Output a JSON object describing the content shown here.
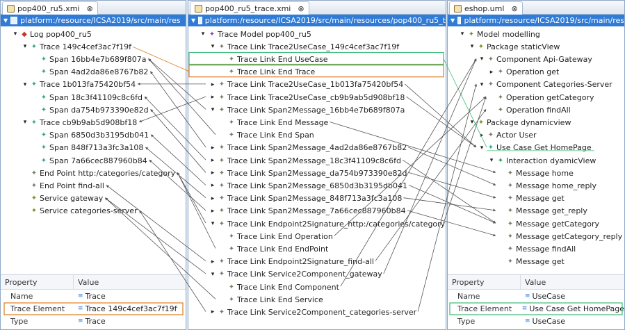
{
  "panels": {
    "left": {
      "tab_title": "pop400_ru5.xmi",
      "tab_close": "⊗",
      "path": "platform:/resource/ICSA2019/src/main/res",
      "tree": [
        {
          "label": "Log pop400_ru5",
          "depth": 1,
          "twisty": "▾",
          "icon": "◆",
          "color": "red"
        },
        {
          "label": "Trace 149c4cef3ac7f19f",
          "depth": 2,
          "twisty": "▾",
          "icon": "✦",
          "color": "teal"
        },
        {
          "label": "Span 16bb4e7b689f807a",
          "depth": 3,
          "twisty": "",
          "icon": "✦",
          "color": "teal"
        },
        {
          "label": "Span 4ad2da86e8767b82",
          "depth": 3,
          "twisty": "",
          "icon": "✦",
          "color": "teal"
        },
        {
          "label": "Trace 1b013fa75420bf54",
          "depth": 2,
          "twisty": "▾",
          "icon": "✦",
          "color": "teal"
        },
        {
          "label": "Span 18c3f41109c8c6fd",
          "depth": 3,
          "twisty": "",
          "icon": "✦",
          "color": "teal"
        },
        {
          "label": "Span da754b973390e82d",
          "depth": 3,
          "twisty": "",
          "icon": "✦",
          "color": "teal"
        },
        {
          "label": "Trace cb9b9ab5d908bf18",
          "depth": 2,
          "twisty": "▾",
          "icon": "✦",
          "color": "teal"
        },
        {
          "label": "Span 6850d3b3195db041",
          "depth": 3,
          "twisty": "",
          "icon": "✦",
          "color": "teal"
        },
        {
          "label": "Span 848f713a3fc3a108",
          "depth": 3,
          "twisty": "",
          "icon": "✦",
          "color": "teal"
        },
        {
          "label": "Span 7a66cec887960b84",
          "depth": 3,
          "twisty": "",
          "icon": "✦",
          "color": "teal"
        },
        {
          "label": "End Point http:/categories/category",
          "depth": 2,
          "twisty": "",
          "icon": "✦",
          "color": "gray"
        },
        {
          "label": "End Point find-all",
          "depth": 2,
          "twisty": "",
          "icon": "✦",
          "color": "gray"
        },
        {
          "label": "Service gateway",
          "depth": 2,
          "twisty": "",
          "icon": "✦",
          "color": "olive"
        },
        {
          "label": "Service categories-server",
          "depth": 2,
          "twisty": "",
          "icon": "✦",
          "color": "olive"
        }
      ],
      "props": {
        "col_property": "Property",
        "col_value": "Value",
        "rows": [
          {
            "name": "Name",
            "value": "Trace"
          },
          {
            "name": "Trace Element",
            "value": "Trace 149c4cef3ac7f19f"
          },
          {
            "name": "Type",
            "value": "Trace"
          }
        ]
      }
    },
    "middle": {
      "tab_title": "pop400_ru5_trace.xmi",
      "tab_close": "⊗",
      "path": "platform:/resource/ICSA2019/src/main/resources/pop400_ru5_t",
      "tree": [
        {
          "label": "Trace Model pop400_ru5",
          "depth": 1,
          "twisty": "▾",
          "icon": "✦",
          "color": "purple"
        },
        {
          "label": "Trace Link Trace2UseCase_149c4cef3ac7f19f",
          "depth": 2,
          "twisty": "▾",
          "icon": "✦",
          "color": "gray"
        },
        {
          "label": "Trace Link End UseCase",
          "depth": 3,
          "twisty": "",
          "icon": "✦",
          "color": "gray"
        },
        {
          "label": "Trace Link End Trace",
          "depth": 3,
          "twisty": "",
          "icon": "✦",
          "color": "gray"
        },
        {
          "label": "Trace Link Trace2UseCase_1b013fa75420bf54",
          "depth": 2,
          "twisty": "▸",
          "icon": "✦",
          "color": "gray"
        },
        {
          "label": "Trace Link Trace2UseCase_cb9b9ab5d908bf18",
          "depth": 2,
          "twisty": "▸",
          "icon": "✦",
          "color": "gray"
        },
        {
          "label": "Trace Link Span2Message_16bb4e7b689f807a",
          "depth": 2,
          "twisty": "▾",
          "icon": "✦",
          "color": "gray"
        },
        {
          "label": "Trace Link End Message",
          "depth": 3,
          "twisty": "",
          "icon": "✦",
          "color": "gray"
        },
        {
          "label": "Trace Link End Span",
          "depth": 3,
          "twisty": "",
          "icon": "✦",
          "color": "gray"
        },
        {
          "label": "Trace Link Span2Message_4ad2da86e8767b82",
          "depth": 2,
          "twisty": "▸",
          "icon": "✦",
          "color": "gray"
        },
        {
          "label": "Trace Link Span2Message_18c3f41109c8c6fd",
          "depth": 2,
          "twisty": "▸",
          "icon": "✦",
          "color": "gray"
        },
        {
          "label": "Trace Link Span2Message_da754b973390e82d",
          "depth": 2,
          "twisty": "▸",
          "icon": "✦",
          "color": "gray"
        },
        {
          "label": "Trace Link Span2Message_6850d3b3195db041",
          "depth": 2,
          "twisty": "▸",
          "icon": "✦",
          "color": "gray"
        },
        {
          "label": "Trace Link Span2Message_848f713a3fc3a108",
          "depth": 2,
          "twisty": "▸",
          "icon": "✦",
          "color": "gray"
        },
        {
          "label": "Trace Link Span2Message_7a66cec887960b84",
          "depth": 2,
          "twisty": "▸",
          "icon": "✦",
          "color": "gray"
        },
        {
          "label": "Trace Link Endpoint2Signature_http:/categories/category",
          "depth": 2,
          "twisty": "▾",
          "icon": "✦",
          "color": "gray"
        },
        {
          "label": "Trace Link End Operation",
          "depth": 3,
          "twisty": "",
          "icon": "✦",
          "color": "gray"
        },
        {
          "label": "Trace Link End EndPoint",
          "depth": 3,
          "twisty": "",
          "icon": "✦",
          "color": "gray"
        },
        {
          "label": "Trace Link Endpoint2Signature_find-all",
          "depth": 2,
          "twisty": "▸",
          "icon": "✦",
          "color": "gray"
        },
        {
          "label": "Trace Link Service2Component_gateway",
          "depth": 2,
          "twisty": "▾",
          "icon": "✦",
          "color": "gray"
        },
        {
          "label": "Trace Link End Component",
          "depth": 3,
          "twisty": "",
          "icon": "✦",
          "color": "gray"
        },
        {
          "label": "Trace Link End Service",
          "depth": 3,
          "twisty": "",
          "icon": "✦",
          "color": "gray"
        },
        {
          "label": "Trace Link Service2Component_categories-server",
          "depth": 2,
          "twisty": "▸",
          "icon": "✦",
          "color": "gray"
        }
      ]
    },
    "right": {
      "tab_title": "eshop.uml",
      "tab_close": "⊗",
      "path": "platform:/resource/ICSA2019/src/main/res",
      "tree": [
        {
          "label": "Model modelling",
          "depth": 1,
          "twisty": "▾",
          "icon": "✦",
          "color": "olive"
        },
        {
          "label": "Package staticView",
          "depth": 2,
          "twisty": "▾",
          "icon": "✦",
          "color": "olive"
        },
        {
          "label": "Component Api-Gateway",
          "depth": 3,
          "twisty": "▾",
          "icon": "✦",
          "color": "gray"
        },
        {
          "label": "Operation get",
          "depth": 4,
          "twisty": "▸",
          "icon": "✦",
          "color": "gray"
        },
        {
          "label": "Component Categories-Server",
          "depth": 3,
          "twisty": "▾",
          "icon": "✦",
          "color": "gray"
        },
        {
          "label": "Operation getCategory",
          "depth": 4,
          "twisty": "",
          "icon": "✦",
          "color": "gray"
        },
        {
          "label": "Operation findAll",
          "depth": 4,
          "twisty": "",
          "icon": "✦",
          "color": "gray"
        },
        {
          "label": "Package dynamicview",
          "depth": 2,
          "twisty": "▾",
          "icon": "✦",
          "color": "olive"
        },
        {
          "label": "Actor User",
          "depth": 3,
          "twisty": "▸",
          "icon": "✦",
          "color": "gray"
        },
        {
          "label": "Use Case Get HomePage",
          "depth": 3,
          "twisty": "▾",
          "icon": "✦",
          "color": "teal"
        },
        {
          "label": "Interaction dyamicView",
          "depth": 4,
          "twisty": "▾",
          "icon": "✦",
          "color": "green"
        },
        {
          "label": "Message home",
          "depth": 5,
          "twisty": "",
          "icon": "✦",
          "color": "gray"
        },
        {
          "label": "Message home_reply",
          "depth": 5,
          "twisty": "",
          "icon": "✦",
          "color": "gray"
        },
        {
          "label": "Message get",
          "depth": 5,
          "twisty": "",
          "icon": "✦",
          "color": "gray"
        },
        {
          "label": "Message get_reply",
          "depth": 5,
          "twisty": "",
          "icon": "✦",
          "color": "gray"
        },
        {
          "label": "Message getCategory",
          "depth": 5,
          "twisty": "",
          "icon": "✦",
          "color": "gray"
        },
        {
          "label": "Message getCategory_reply",
          "depth": 5,
          "twisty": "",
          "icon": "✦",
          "color": "gray"
        },
        {
          "label": "Message findAll",
          "depth": 5,
          "twisty": "",
          "icon": "✦",
          "color": "gray"
        },
        {
          "label": "Message get",
          "depth": 5,
          "twisty": "",
          "icon": "✦",
          "color": "gray"
        }
      ],
      "props": {
        "col_property": "Property",
        "col_value": "Value",
        "rows": [
          {
            "name": "Name",
            "value": "UseCase"
          },
          {
            "name": "Trace Element",
            "value": "Use Case Get HomePage"
          },
          {
            "name": "Type",
            "value": "UseCase"
          }
        ]
      }
    }
  },
  "colors": {
    "selection_bar": "#2f7bd6",
    "highlight_orange": "#e07b20",
    "highlight_green": "#3dbb7a",
    "link_line": "#555555"
  }
}
